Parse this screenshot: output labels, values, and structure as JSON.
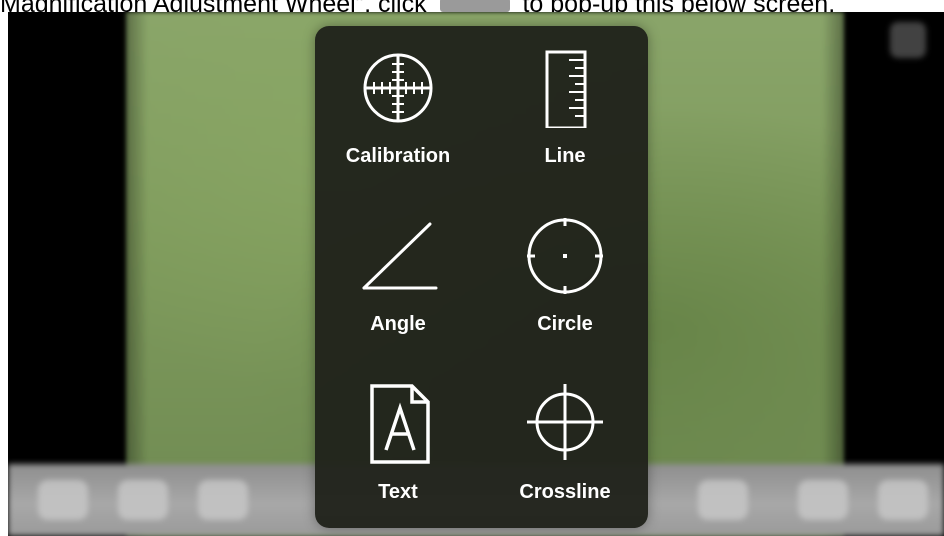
{
  "instruction": {
    "prefix": "Magnification Adjustment Wheel”, click",
    "suffix": "to pop-up this below screen."
  },
  "menu": {
    "items": [
      {
        "label": "Calibration",
        "icon": "calibration-icon"
      },
      {
        "label": "Line",
        "icon": "ruler-icon"
      },
      {
        "label": "Angle",
        "icon": "angle-icon"
      },
      {
        "label": "Circle",
        "icon": "circle-icon"
      },
      {
        "label": "Text",
        "icon": "text-document-icon"
      },
      {
        "label": "Crossline",
        "icon": "crosshair-icon"
      }
    ]
  },
  "colors": {
    "menu_background": "#20221b",
    "label": "#ffffff",
    "icon_stroke": "#ffffff",
    "camera_green": "#7e9a5c"
  }
}
